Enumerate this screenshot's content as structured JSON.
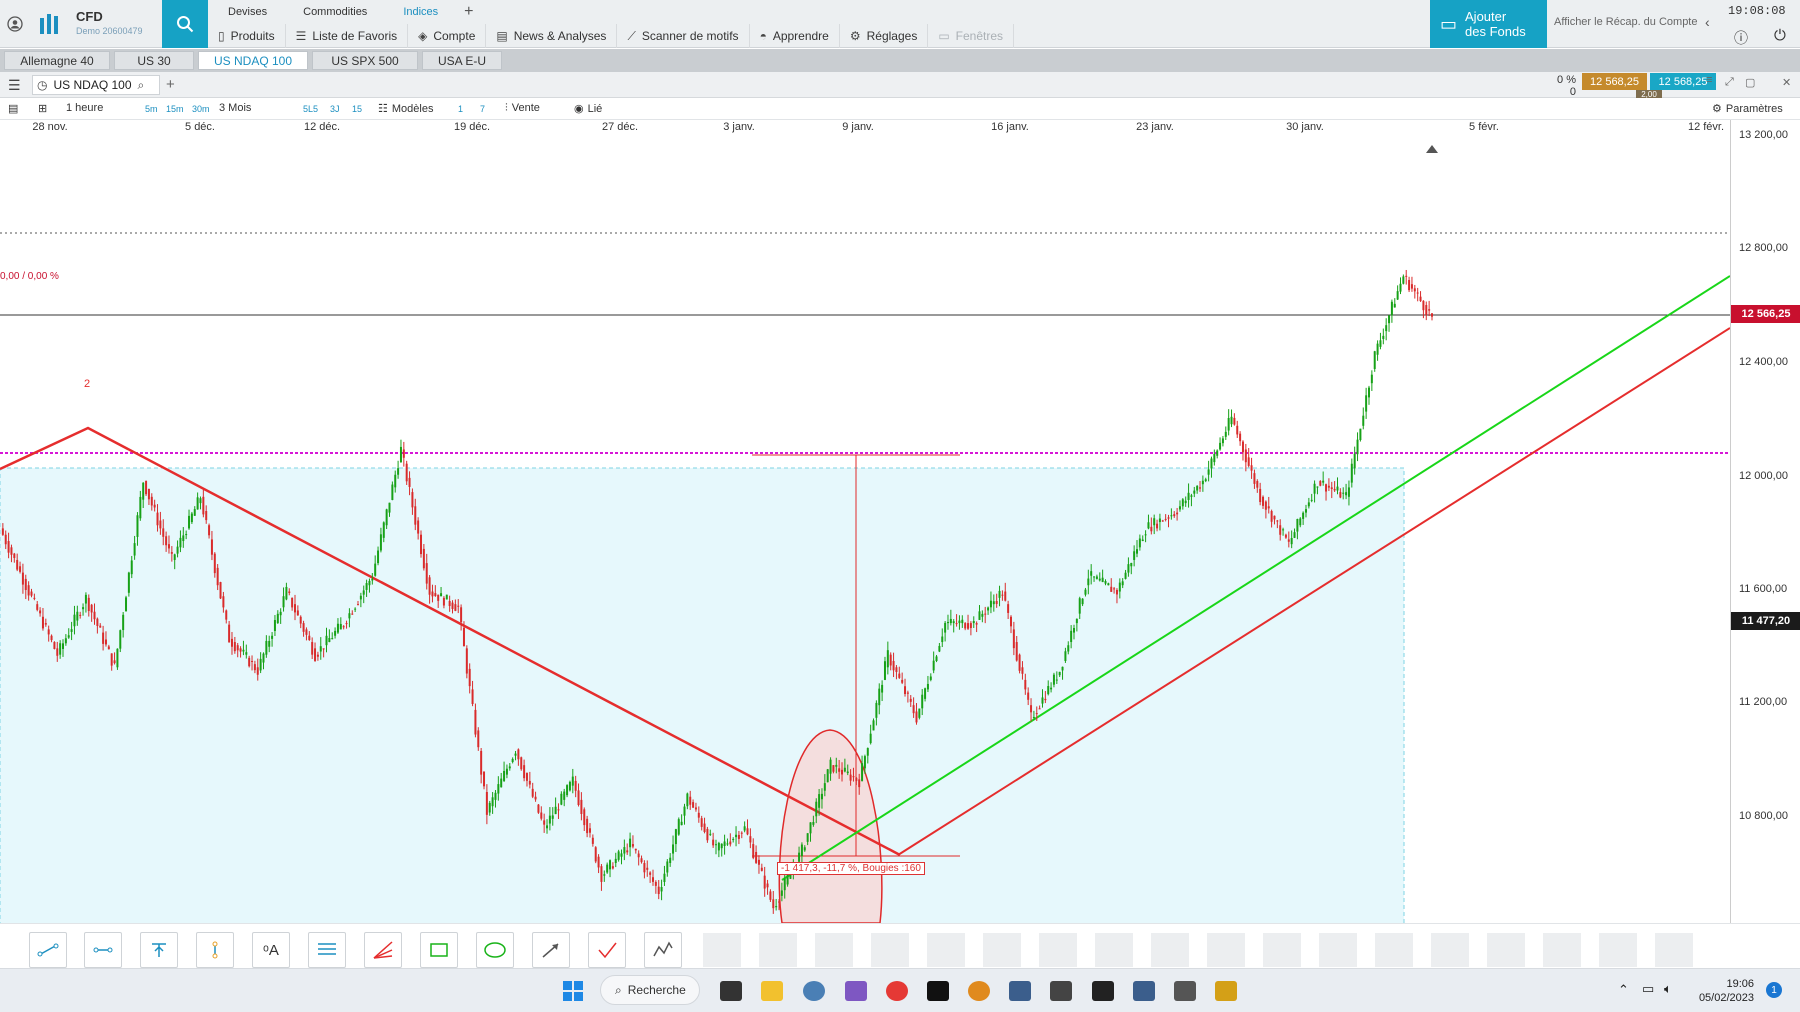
{
  "app": {
    "brand": "CFD",
    "account": "Demo 20600479",
    "clock": "19:08:08",
    "recap_link": "Afficher le Récap. du Compte",
    "add_funds": "Ajouter\ndes Fonds"
  },
  "categories": [
    "Devises",
    "Commodities",
    "Indices"
  ],
  "categories_active": "Indices",
  "menu": [
    {
      "label": "Produits",
      "icon": "product-icon"
    },
    {
      "label": "Liste de Favoris",
      "icon": "list-icon"
    },
    {
      "label": "Compte",
      "icon": "tag-icon"
    },
    {
      "label": "News & Analyses",
      "icon": "news-icon"
    },
    {
      "label": "Scanner de motifs",
      "icon": "scanner-icon"
    },
    {
      "label": "Apprendre",
      "icon": "learn-icon"
    },
    {
      "label": "Réglages",
      "icon": "gear-icon"
    },
    {
      "label": "Fenêtres",
      "icon": "window-icon"
    }
  ],
  "market_tabs": [
    "Allemagne 40",
    "US 30",
    "US NDAQ 100",
    "US SPX 500",
    "USA E-U"
  ],
  "market_tab_active": "US NDAQ 100",
  "chart_header": {
    "instrument": "US NDAQ 100",
    "change_pct": "0 %",
    "change_abs": "0",
    "bid": "12 568,25",
    "ask": "12 568,25",
    "spread": "2,00"
  },
  "toolbar": {
    "interval": "1 heure",
    "quick_intervals": [
      "5m",
      "15m",
      "30m"
    ],
    "range": "3 Mois",
    "ranges": [
      "5L5",
      "3J",
      "15"
    ],
    "models": "Modèles",
    "nums": [
      "1",
      "7"
    ],
    "sell": "Vente",
    "linked": "Lié",
    "settings": "Paramètres"
  },
  "axes": {
    "x_labels": [
      "28 nov.",
      "5 déc.",
      "12 déc.",
      "19 déc.",
      "27 déc.",
      "3 janv.",
      "9 janv.",
      "16 janv.",
      "23 janv.",
      "30 janv.",
      "5 févr.",
      "12 févr."
    ],
    "y_labels": [
      "13 200,00",
      "12 800,00",
      "12 400,00",
      "12 000,00",
      "11 600,00",
      "11 200,00",
      "10 800,00"
    ],
    "current_price": "12 566,25",
    "cursor_price": "11 477,20",
    "pct_label": "0,00 / 0,00 %",
    "measure_label": "-1 417,3, -11,7 %, Bougies :160",
    "point_label": "2"
  },
  "chart_data": {
    "type": "line",
    "instrument": "US NDAQ 100",
    "x_range": [
      "28 nov.",
      "12 févr."
    ],
    "ylim": [
      10650,
      13200
    ],
    "series": [
      {
        "values": [
          11900,
          11700,
          11500,
          11680,
          11460,
          12050,
          11800,
          12000,
          11550,
          11450,
          11700,
          11500,
          11600,
          11750,
          12150,
          11700,
          11650,
          11000,
          11200,
          10950,
          11100,
          10800,
          10900,
          10750,
          11050,
          10880,
          10950,
          10700,
          10880,
          11150,
          11100,
          11500,
          11300,
          11600,
          11600,
          11700,
          11300,
          11450,
          11750,
          11700,
          11900,
          11950,
          12050,
          12250,
          12000,
          11850,
          12050,
          12000,
          12450,
          12700,
          12568
        ]
      }
    ],
    "horizontal_levels": [
      12820,
      12566.25,
      12082
    ],
    "grid": false
  },
  "taskbar": {
    "search": "Recherche",
    "time": "19:06",
    "date": "05/02/2023",
    "notifications": "1"
  }
}
